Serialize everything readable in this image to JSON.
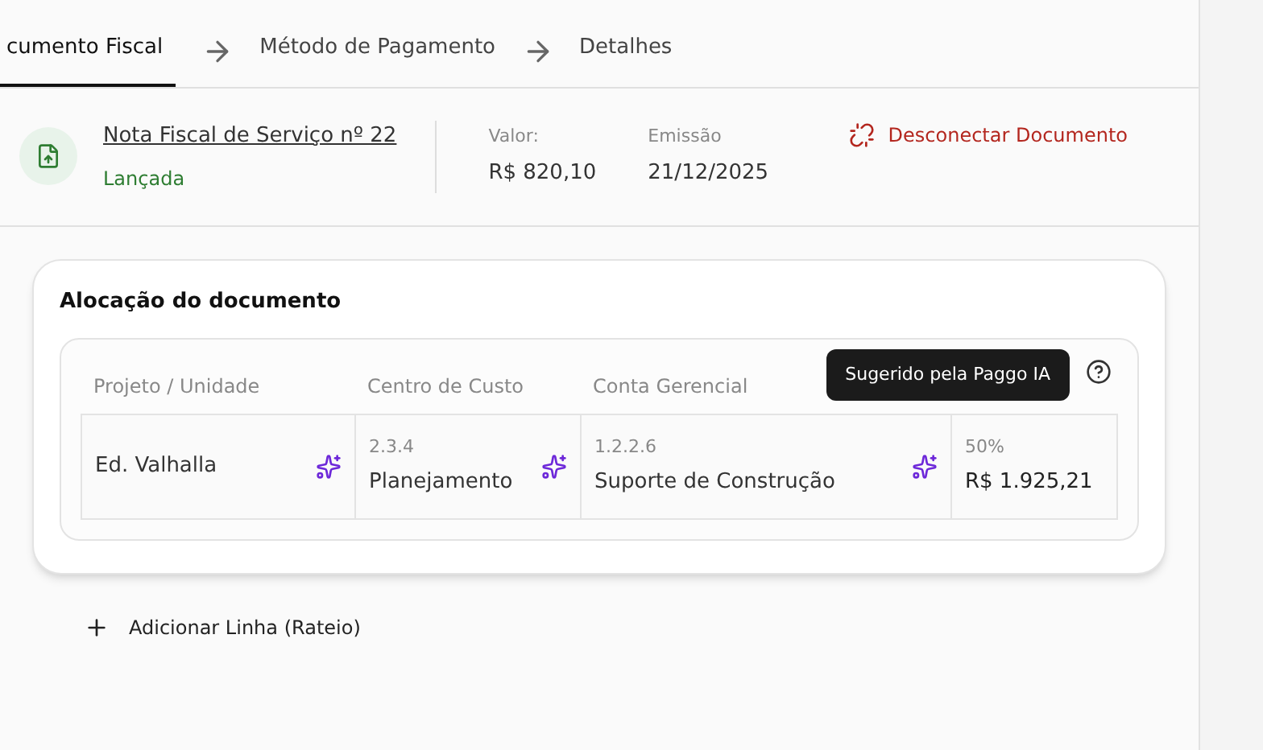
{
  "steps": [
    {
      "label": "cumento Fiscal",
      "selected": true
    },
    {
      "label": "Método de Pagamento",
      "selected": false
    },
    {
      "label": "Detalhes",
      "selected": false
    }
  ],
  "document": {
    "title": "Nota Fiscal de Serviço nº 22",
    "status": "Lançada",
    "fields": [
      {
        "label": "Valor:",
        "value": "R$ 820,10"
      },
      {
        "label": "Emissão",
        "value": "21/12/2025"
      }
    ],
    "disconnect": "Desconectar Documento"
  },
  "allocation": {
    "title": "Alocação do documento",
    "columns": [
      "Projeto / Unidade",
      "Centro de Custo",
      "Conta Gerencial"
    ],
    "tooltip": "Sugerido pela Paggo IA",
    "row": [
      {
        "kind": "item",
        "name": "Ed. Valhalla",
        "ai": true
      },
      {
        "kind": "item",
        "code": "2.3.4",
        "name": "Planejamento",
        "ai": true
      },
      {
        "kind": "item",
        "code": "1.2.2.6",
        "name": "Suporte de Construção",
        "ai": true
      },
      {
        "kind": "amount",
        "code": "50%",
        "name": "R$ 1.925,21",
        "ai": false
      }
    ]
  },
  "add_line": "Adicionar Linha (Rateio)"
}
